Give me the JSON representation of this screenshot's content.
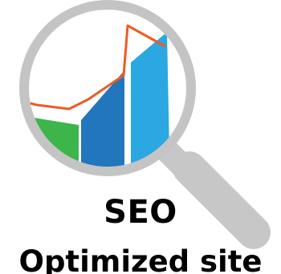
{
  "headline": {
    "line1": "SEO",
    "line2": "Optimized site"
  },
  "icons": {
    "magnifier": "magnifying-glass-icon",
    "chart": "bar-chart-icon",
    "trend": "trend-line-icon"
  },
  "colors": {
    "lens_rim": "#c4c4c4",
    "handle": "#c7c7c7",
    "bar_green": "#3cb54a",
    "bar_dark_blue": "#2276bc",
    "bar_light_blue": "#2ba7e1",
    "trend_line": "#ee5a24",
    "text": "#000000"
  }
}
